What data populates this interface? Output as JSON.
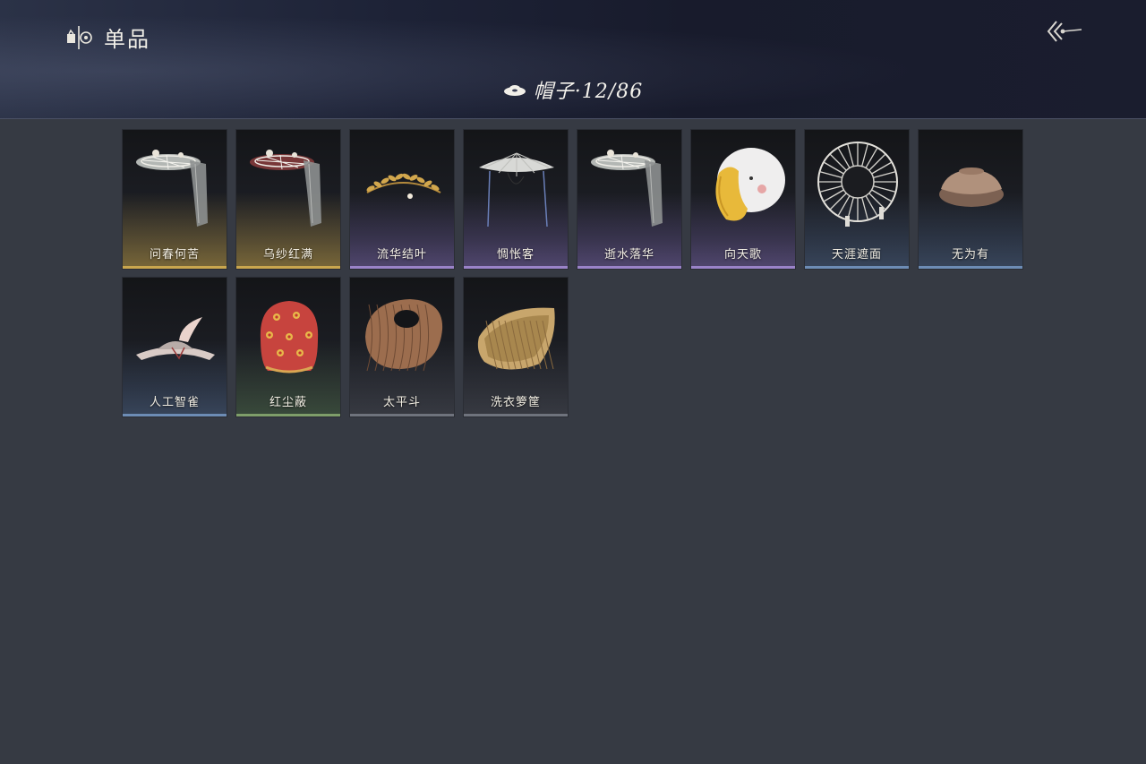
{
  "header": {
    "title": "单品",
    "category": "帽子·12/86"
  },
  "icons": {
    "title": "wardrobe-icon",
    "back": "back-arrow-icon",
    "category": "hat-icon"
  },
  "rarity_colors": {
    "gold": "#c9a64e",
    "purple": "#9a83c8",
    "blue": "#6d8cb5",
    "green": "#7f9e6a",
    "gray": "#6f737d"
  },
  "items": [
    {
      "name": "问春何苦",
      "rarity": "gold",
      "icon": "veiled-hat-icon"
    },
    {
      "name": "乌纱红满",
      "rarity": "gold",
      "icon": "veiled-hat-icon"
    },
    {
      "name": "流华结叶",
      "rarity": "purple",
      "icon": "laurel-crown-icon"
    },
    {
      "name": "惆怅客",
      "rarity": "purple",
      "icon": "bamboo-hat-icon"
    },
    {
      "name": "逝水落华",
      "rarity": "purple",
      "icon": "veiled-hat-icon"
    },
    {
      "name": "向天歌",
      "rarity": "purple",
      "icon": "goose-hood-icon"
    },
    {
      "name": "天涯遮面",
      "rarity": "blue",
      "icon": "wheel-hat-icon"
    },
    {
      "name": "无为有",
      "rarity": "blue",
      "icon": "bowl-hat-icon"
    },
    {
      "name": "人工智雀",
      "rarity": "blue",
      "icon": "bird-hat-icon"
    },
    {
      "name": "红尘蔽",
      "rarity": "green",
      "icon": "red-hood-icon"
    },
    {
      "name": "太平斗",
      "rarity": "gray",
      "icon": "woven-basket-icon"
    },
    {
      "name": "洗衣箩筐",
      "rarity": "gray",
      "icon": "wicker-basket-icon"
    }
  ]
}
